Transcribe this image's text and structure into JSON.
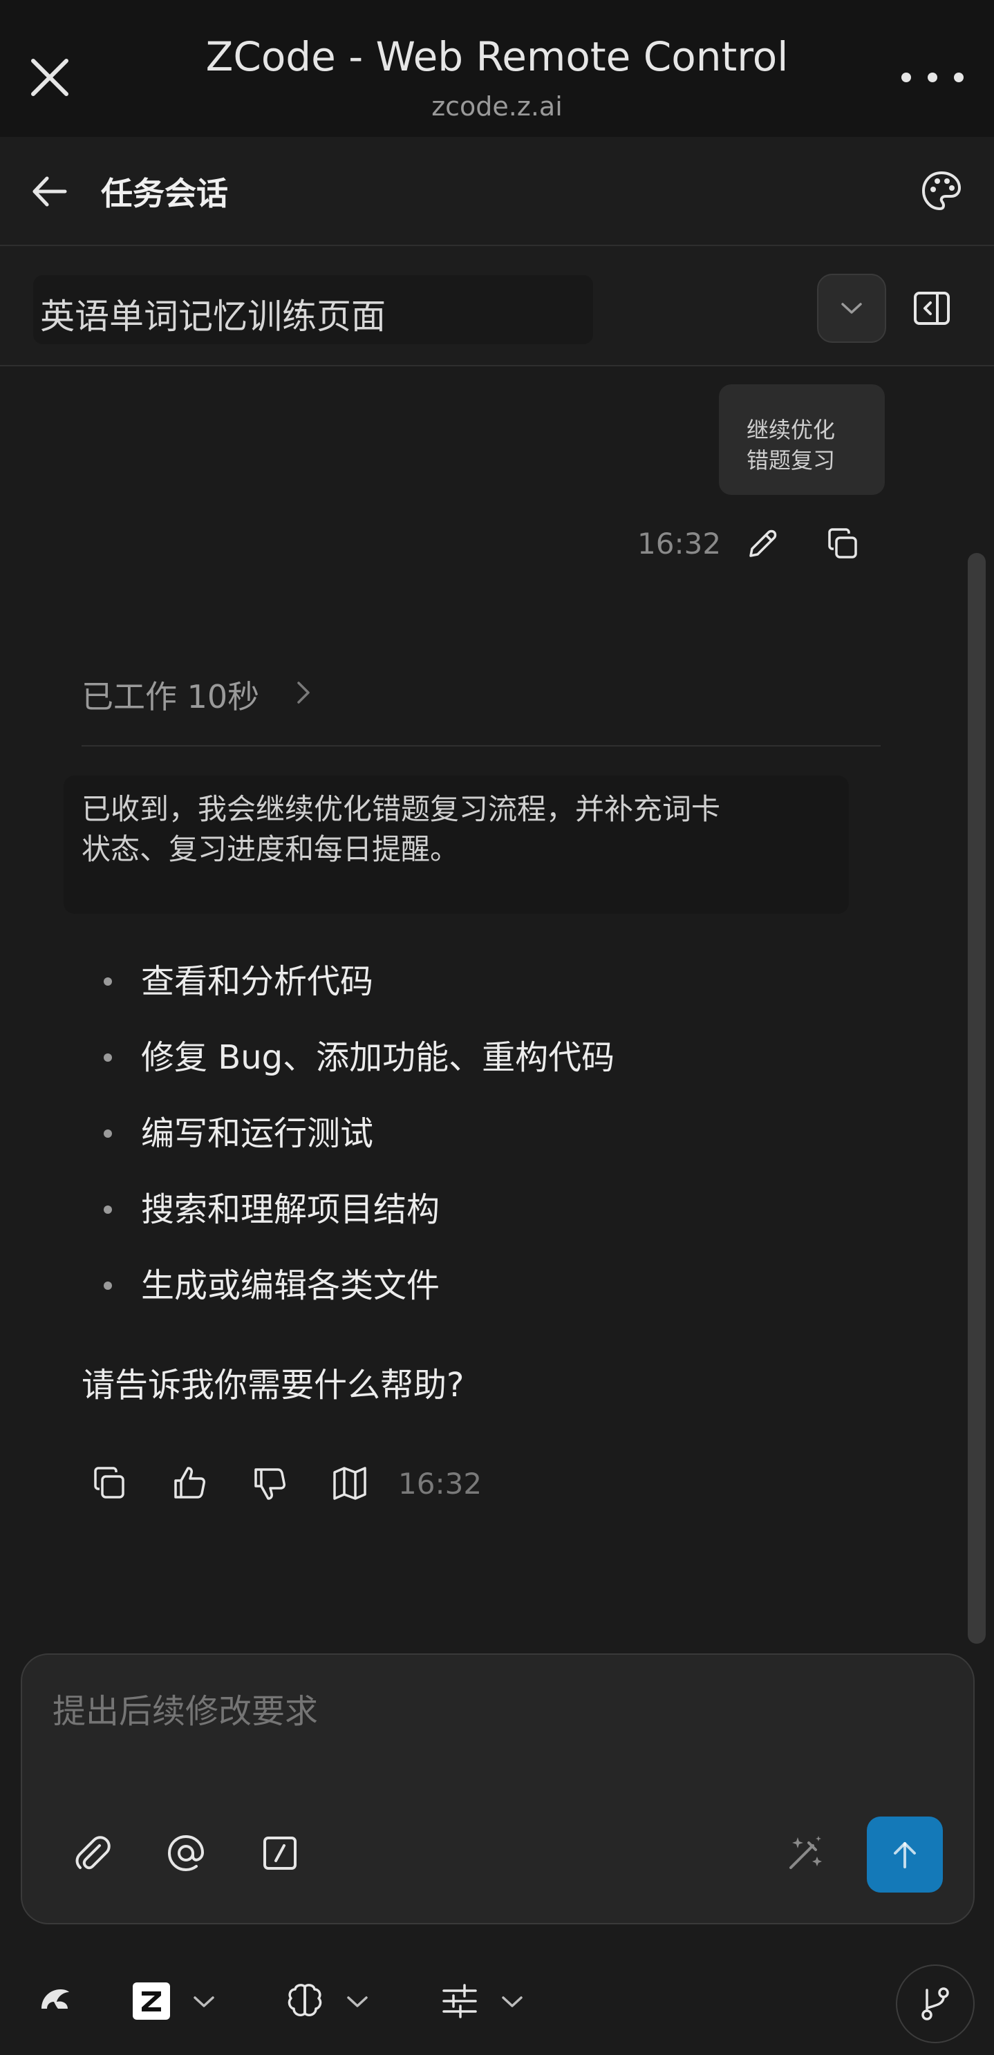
{
  "browser": {
    "title": "ZCode - Web Remote Control",
    "url": "zcode.z.ai"
  },
  "header": {
    "title": "任务会话"
  },
  "session": {
    "name": "英语单词记忆训练页面"
  },
  "user_message": {
    "text_line1": "继续优化",
    "text_line2": "错题复习",
    "time": "16:32"
  },
  "assistant": {
    "worked_label": "已工作 10秒",
    "reply_line1": "已收到，我会继续优化错题复习流程，并补充词卡",
    "reply_line2": "状态、复习进度和每日提醒。",
    "bullets": [
      "查看和分析代码",
      "修复 Bug、添加功能、重构代码",
      "编写和运行测试",
      "搜索和理解项目结构",
      "生成或编辑各类文件"
    ],
    "question": "请告诉我你需要什么帮助?",
    "time": "16:32"
  },
  "composer": {
    "placeholder": "提出后续修改要求"
  },
  "colors": {
    "send_button": "#1479b8",
    "background": "#1b1b1b"
  }
}
